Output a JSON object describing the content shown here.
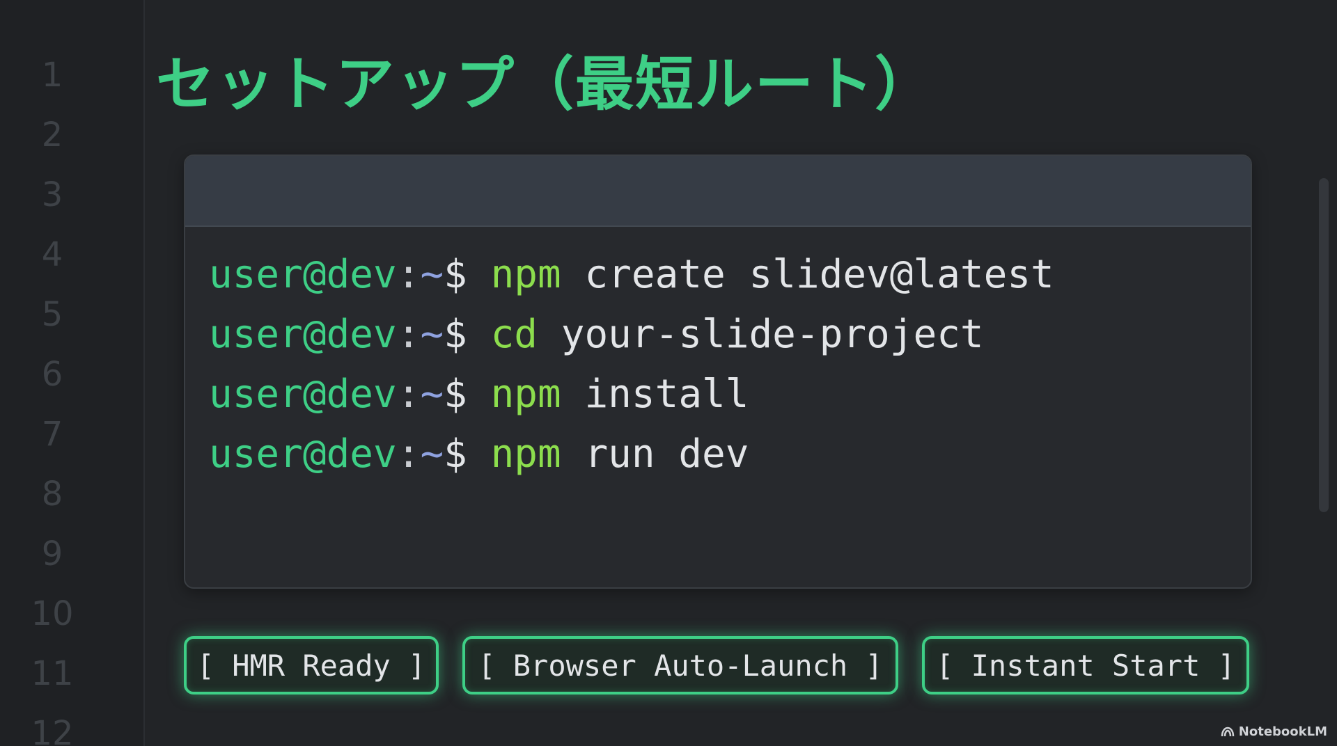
{
  "editor": {
    "line_numbers": [
      "1",
      "2",
      "3",
      "4",
      "5",
      "6",
      "7",
      "8",
      "9",
      "10",
      "11",
      "12"
    ]
  },
  "slide": {
    "title": "セットアップ（最短ルート）"
  },
  "terminal": {
    "prompt": {
      "user_host": "user@dev",
      "colon": ":",
      "tilde": "~",
      "dollar": "$"
    },
    "commands": [
      {
        "tool": "npm",
        "args": "create slidev@latest"
      },
      {
        "tool": "cd",
        "args": "your-slide-project"
      },
      {
        "tool": "npm",
        "args": "install"
      },
      {
        "tool": "npm",
        "args": "run dev"
      }
    ]
  },
  "badges": [
    {
      "label": "[ HMR Ready ]"
    },
    {
      "label": "[ Browser Auto-Launch ]"
    },
    {
      "label": "[ Instant Start ]"
    }
  ],
  "watermark": {
    "label": "NotebookLM",
    "icon": "notebooklm-logo-icon"
  },
  "colors": {
    "background": "#222427",
    "accent_green": "#3ecf86",
    "command_green": "#8cdd4d",
    "text": "#e3e5e8",
    "line_number": "#3e4247"
  }
}
